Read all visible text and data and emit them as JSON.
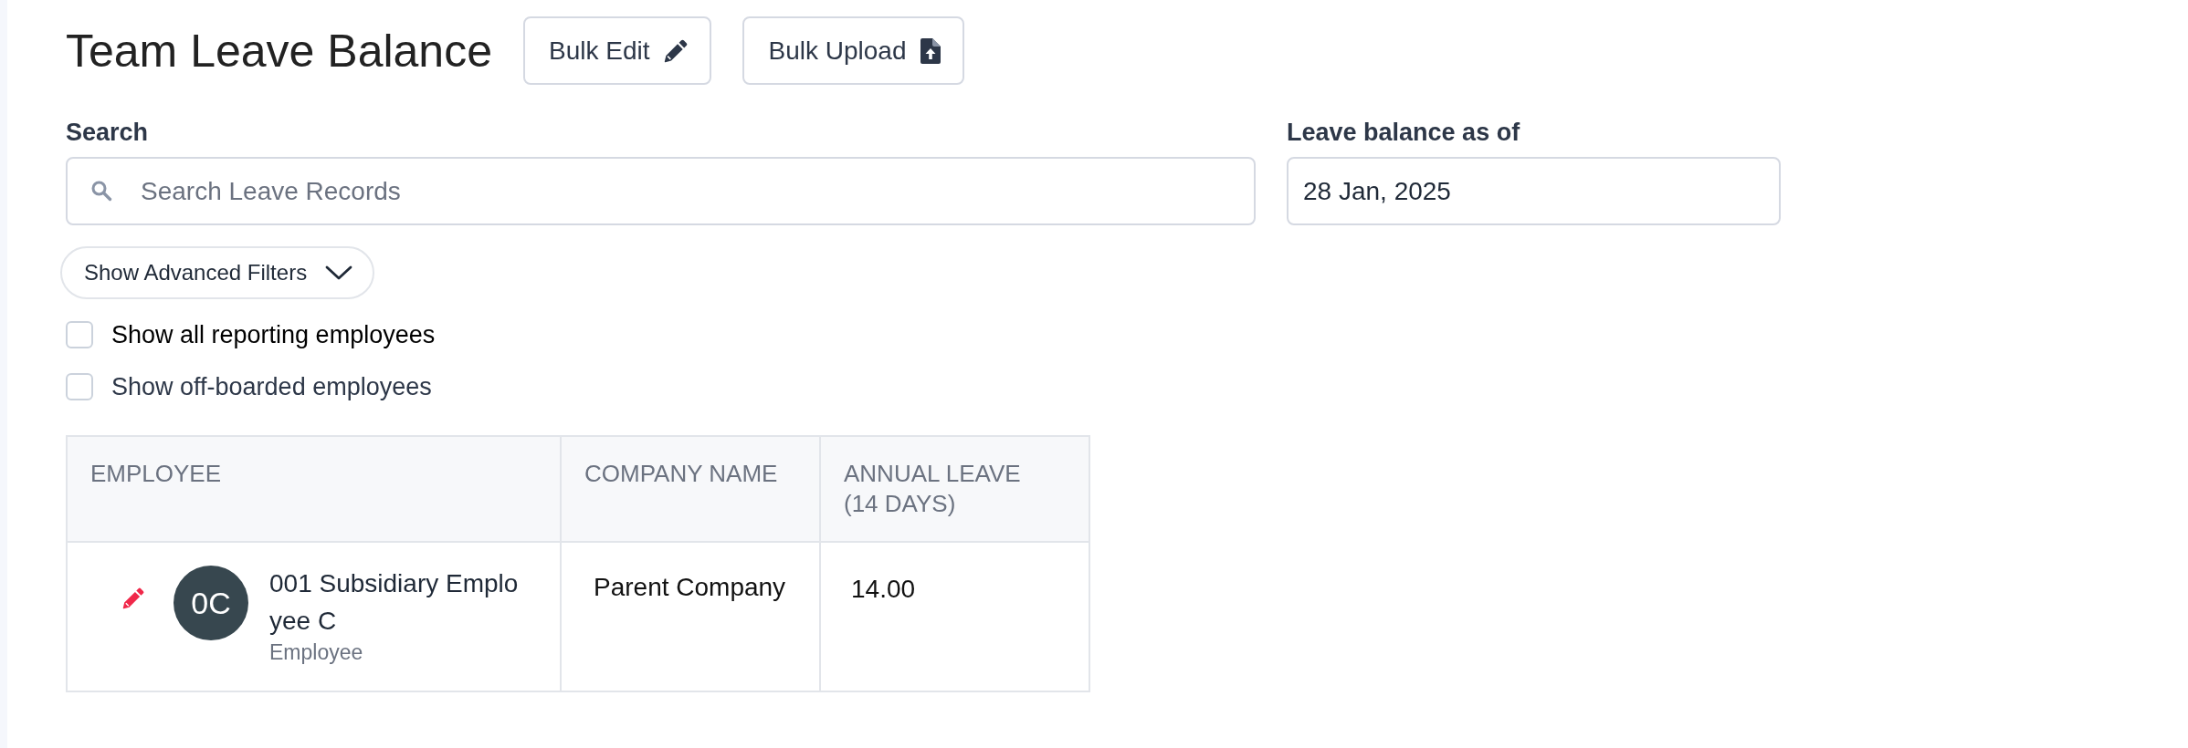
{
  "page": {
    "title": "Team Leave Balance"
  },
  "toolbar_buttons": [
    {
      "label": "Bulk Edit",
      "kind": "edit"
    },
    {
      "label": "Bulk Upload",
      "kind": "upload"
    }
  ],
  "filters": {
    "search": {
      "label": "Search",
      "placeholder": "Search Leave Records"
    },
    "date": {
      "label": "Leave balance as of",
      "value": "28 Jan, 2025"
    }
  },
  "advanced_filters": {
    "label": "Show Advanced Filters",
    "expanded": false
  },
  "checkboxes": [
    {
      "label": "Show all reporting employees",
      "checked": false
    },
    {
      "label": "Show off-boarded employees",
      "checked": false
    }
  ],
  "table": {
    "columns": [
      "EMPLOYEE",
      "COMPANY NAME",
      "ANNUAL LEAVE (14 DAYS)"
    ],
    "rows": [
      {
        "initials": "0C",
        "name": "001 Subsidiary Employee C",
        "role": "Employee",
        "company": "Parent Company",
        "annual_leave": "14.00"
      }
    ]
  }
}
